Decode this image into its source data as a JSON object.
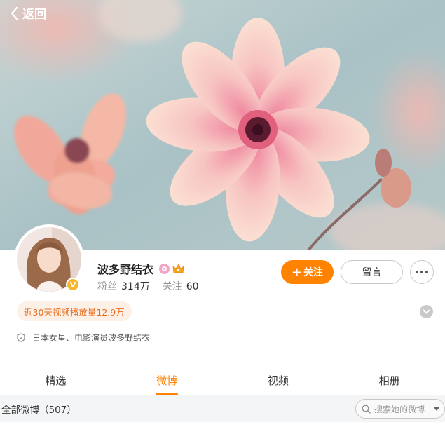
{
  "header": {
    "back_label": "返回"
  },
  "profile": {
    "name": "波多野结衣",
    "followers_label": "粉丝",
    "followers_value": "314万",
    "following_label": "关注",
    "following_value": "60",
    "views_tag": "近30天视频播放量12.9万",
    "bio": "日本女星、电影演员波多野结衣"
  },
  "actions": {
    "follow_label": "关注",
    "message_label": "留言"
  },
  "tabs": [
    {
      "label": "精选",
      "active": false
    },
    {
      "label": "微博",
      "active": true
    },
    {
      "label": "视频",
      "active": false
    },
    {
      "label": "相册",
      "active": false
    }
  ],
  "subbar": {
    "all_posts": "全部微博（507）",
    "search_placeholder": "搜索她的微博"
  },
  "colors": {
    "accent": "#ff8200",
    "verified": "#f7b62a",
    "views_tag_text": "#e86b1c"
  }
}
